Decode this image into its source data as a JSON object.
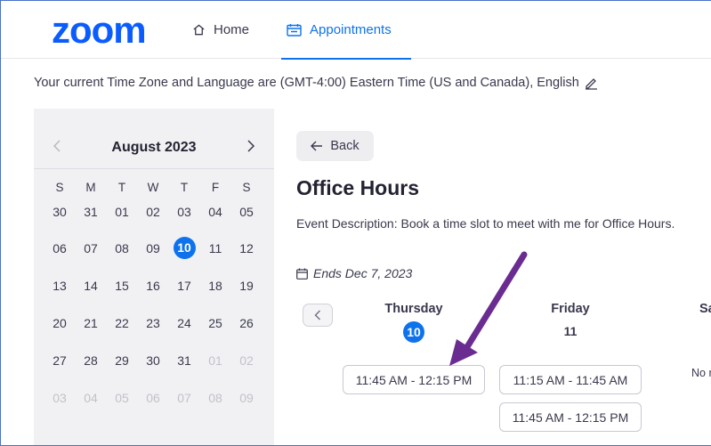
{
  "header": {
    "logo_text": "zoom",
    "nav": {
      "home_label": "Home",
      "appointments_label": "Appointments"
    }
  },
  "timezone_line": "Your current Time Zone and Language are (GMT-4:00) Eastern Time (US and Canada), English",
  "calendar": {
    "month_label": "August 2023",
    "weekdays": [
      "S",
      "M",
      "T",
      "W",
      "T",
      "F",
      "S"
    ],
    "weeks": [
      [
        "30",
        "31",
        "01",
        "02",
        "03",
        "04",
        "05"
      ],
      [
        "06",
        "07",
        "08",
        "09",
        "10",
        "11",
        "12"
      ],
      [
        "13",
        "14",
        "15",
        "16",
        "17",
        "18",
        "19"
      ],
      [
        "20",
        "21",
        "22",
        "23",
        "24",
        "25",
        "26"
      ],
      [
        "27",
        "28",
        "29",
        "30",
        "31",
        "01",
        "02"
      ],
      [
        "03",
        "04",
        "05",
        "06",
        "07",
        "08",
        "09"
      ]
    ],
    "selected_day": "10"
  },
  "main": {
    "back_label": "Back",
    "title": "Office Hours",
    "description": "Event Description: Book a time slot to meet with me for Office Hours.",
    "ends_label": "Ends Dec 7, 2023",
    "days": [
      {
        "name": "Thursday",
        "number": "10",
        "slots": [
          "11:45 AM - 12:15 PM"
        ]
      },
      {
        "name": "Friday",
        "number": "11",
        "slots": [
          "11:15 AM - 11:45 AM",
          "11:45 AM - 12:15 PM"
        ]
      },
      {
        "name": "Sa",
        "number": "",
        "slots": []
      }
    ],
    "no_slots_text": "No r"
  },
  "colors": {
    "accent": "#0e72ed",
    "arrow": "#6b2c91"
  }
}
